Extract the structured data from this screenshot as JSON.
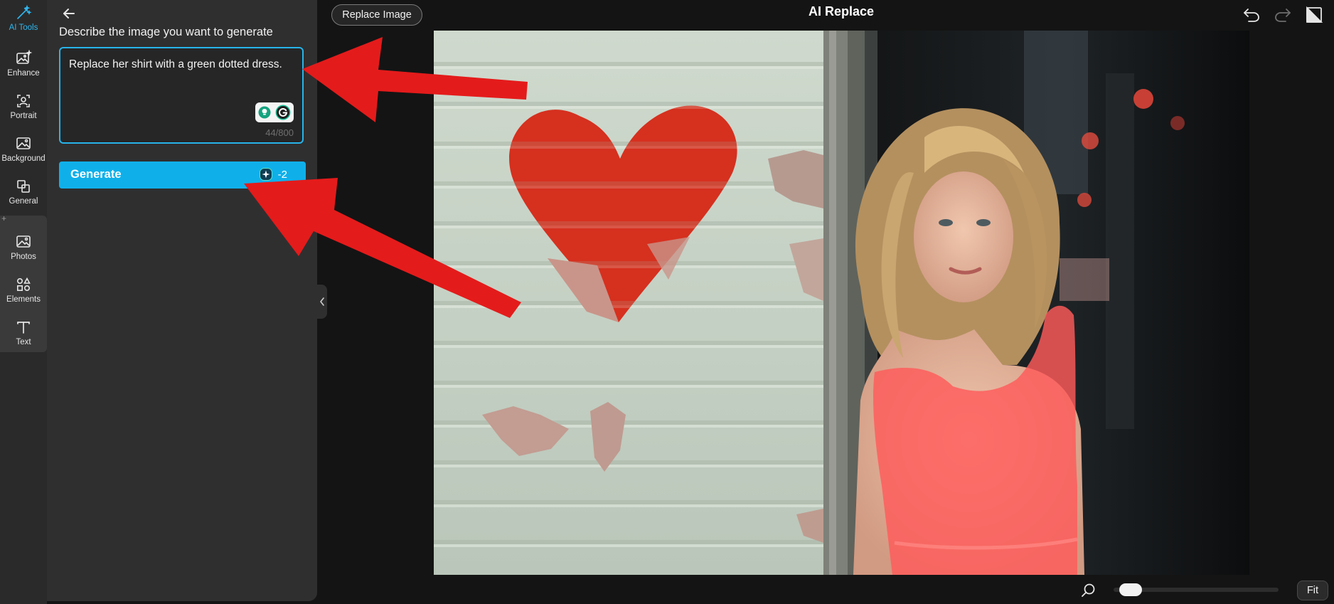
{
  "rail": {
    "items": [
      {
        "label": "AI Tools",
        "icon": "magic-wand-icon"
      },
      {
        "label": "Enhance",
        "icon": "enhance-image-icon"
      },
      {
        "label": "Portrait",
        "icon": "portrait-icon"
      },
      {
        "label": "Background",
        "icon": "background-icon"
      },
      {
        "label": "General",
        "icon": "general-icon"
      },
      {
        "label": "Photos",
        "icon": "photos-icon"
      },
      {
        "label": "Elements",
        "icon": "elements-icon"
      },
      {
        "label": "Text",
        "icon": "text-icon"
      }
    ],
    "plus": "+"
  },
  "panel": {
    "title": "Describe the image you want to generate",
    "prompt_value": "Replace her shirt with a green dotted dress.",
    "char_count": "44/800",
    "generate_label": "Generate",
    "credit_cost": "-2"
  },
  "header": {
    "replace_label": "Replace Image",
    "title": "AI Replace"
  },
  "footer": {
    "fit_label": "Fit",
    "zoom_fraction": 0.05
  },
  "colors": {
    "accent": "#0fb0ea",
    "arrow": "#e41b1b",
    "dress_overlay": "#ff5a5a"
  }
}
